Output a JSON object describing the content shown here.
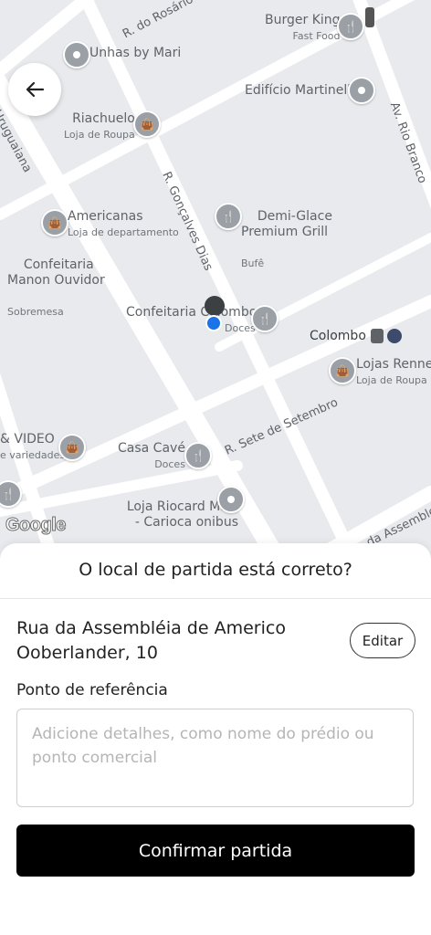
{
  "map": {
    "streets": [
      "R. do Rosário",
      "Uruguaiana",
      "R. Gonçalves Dias",
      "Av. Rio Branco",
      "R. Sete de Setembro",
      "R. da Assembleia"
    ],
    "pois": {
      "burger_king": {
        "name": "Burger King",
        "sub": "Fast Food",
        "icon": "fork-knife-icon"
      },
      "unhas": {
        "name": "Unhas by Mari",
        "sub": "",
        "icon": "place-icon"
      },
      "edificio": {
        "name": "Edifício Martinelli",
        "sub": "",
        "icon": "place-icon"
      },
      "riachuelo": {
        "name": "Riachuelo",
        "sub": "Loja de Roupa",
        "icon": "shopping-bag-icon"
      },
      "demiglace": {
        "name": "Demi-Glace\nPremium Grill",
        "sub": "Bufê",
        "icon": "fork-knife-icon"
      },
      "americanas": {
        "name": "Americanas",
        "sub": "Loja de departamento",
        "icon": "shopping-bag-icon"
      },
      "confeitaria_manon": {
        "name": "Confeitaria\nManon Ouvidor",
        "sub": "Sobremesa",
        "icon": "fork-knife-icon"
      },
      "confeitaria_colombo": {
        "name": "Confeitaria Colombo",
        "sub": "Doces",
        "icon": "fork-knife-icon"
      },
      "colombo": {
        "name": "Colombo",
        "sub": "",
        "icon": "train-icon"
      },
      "lojas_renner": {
        "name": "Lojas Renner",
        "sub": "Loja de Roupa",
        "icon": "shopping-bag-icon"
      },
      "video": {
        "name": "& VIDEO",
        "sub": "e variedades",
        "icon": "shopping-bag-icon"
      },
      "casa_cave": {
        "name": "Casa Cavé",
        "sub": "Doces",
        "icon": "fork-knife-icon"
      },
      "loja_riocard": {
        "name": "Loja Riocard Mais\n- Carioca onibus",
        "sub": "",
        "icon": "place-icon"
      }
    },
    "attribution": "Google"
  },
  "sheet": {
    "title": "O local de partida está correto?",
    "address": "Rua da Assembléia de Americo Ooberlander, 10",
    "edit_label": "Editar",
    "ref_label": "Ponto de referência",
    "ref_placeholder": "Adicione detalhes, como nome do prédio ou ponto comercial",
    "ref_value": "",
    "confirm_label": "Confirmar partida"
  },
  "colors": {
    "map_bg": "#e8eaed",
    "road": "#ffffff",
    "location_dot": "#1a73e8",
    "primary_button": "#000000"
  }
}
